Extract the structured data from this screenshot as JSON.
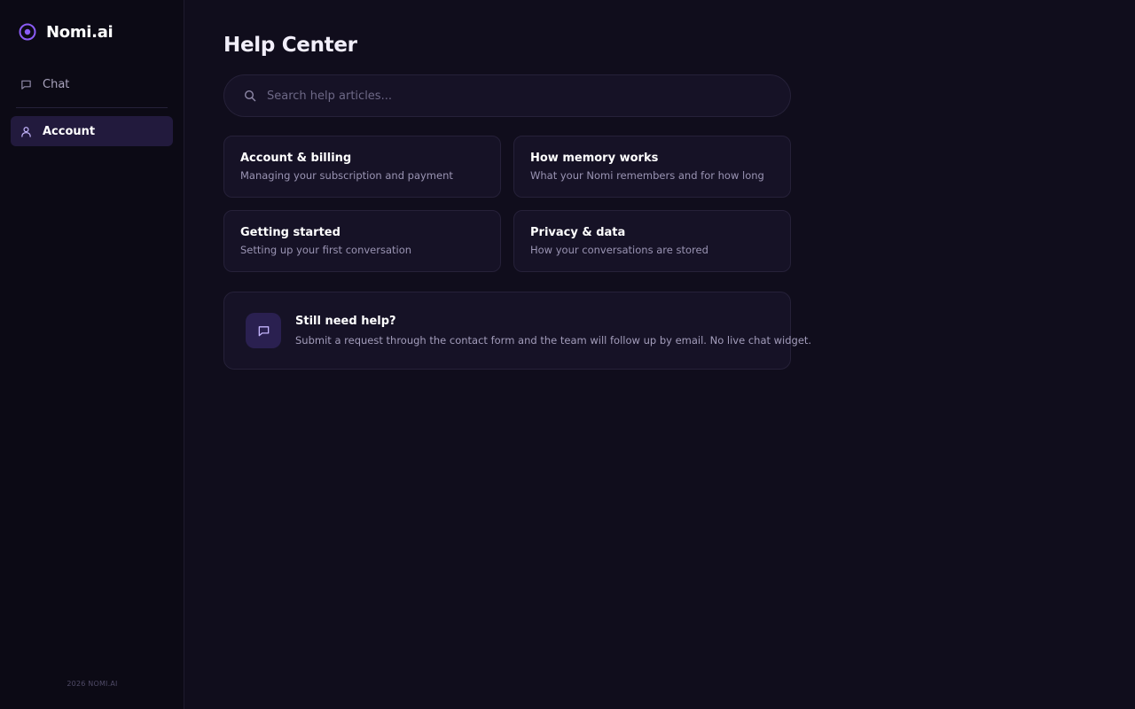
{
  "brand": {
    "name": "Nomi.ai",
    "icon": "nomi-logo-icon",
    "accent_color": "#8b5cf6"
  },
  "sidebar": {
    "items": [
      {
        "label": "Chat",
        "icon": "chat-icon",
        "active": false
      },
      {
        "label": "Account",
        "icon": "user-icon",
        "active": true
      }
    ],
    "footer": "2026 NOMI.AI"
  },
  "main": {
    "title": "Help Center",
    "search": {
      "placeholder": "Search help articles...",
      "value": "",
      "icon": "search-icon"
    },
    "cards": [
      {
        "title": "Account & billing",
        "description": "Managing your subscription and payment"
      },
      {
        "title": "How memory works",
        "description": "What your Nomi remembers and for how long"
      },
      {
        "title": "Getting started",
        "description": "Setting up your first conversation"
      },
      {
        "title": "Privacy & data",
        "description": "How your conversations are stored"
      }
    ],
    "help_box": {
      "icon": "message-icon",
      "title": "Still need help?",
      "description": "Submit a request through the contact form and the team will follow up by email. No live chat widget."
    }
  },
  "colors": {
    "background": "#100d1c",
    "sidebar_bg": "#0c0a15",
    "card_bg": "#161226",
    "active_nav_bg": "#221a3d",
    "accent": "#8b5cf6"
  }
}
